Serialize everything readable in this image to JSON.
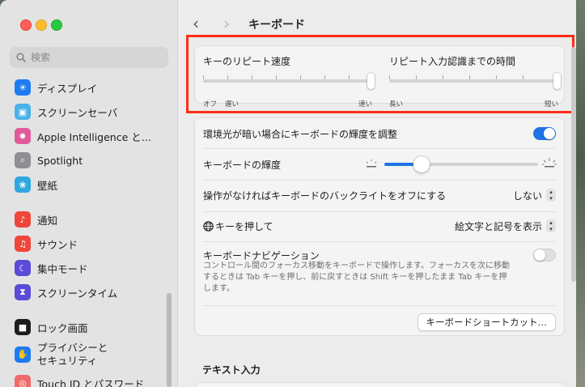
{
  "window": {
    "title": "キーボード"
  },
  "search": {
    "placeholder": "検索"
  },
  "sidebar": {
    "items": [
      {
        "label": "ディスプレイ",
        "icon": "display-icon",
        "color": "#1d7cf2"
      },
      {
        "label": "スクリーンセーバ",
        "icon": "screensaver-icon",
        "color": "#4ab2e8"
      },
      {
        "label": "Apple Intelligence と…",
        "icon": "apple-intelligence-icon",
        "color": "#e05b9c"
      },
      {
        "label": "Spotlight",
        "icon": "magnifier-icon",
        "color": "#8e8e93"
      },
      {
        "label": "壁紙",
        "icon": "wallpaper-icon",
        "color": "#2fa8e0"
      },
      {
        "label": "通知",
        "icon": "bell-icon",
        "color": "#f0453a"
      },
      {
        "label": "サウンド",
        "icon": "speaker-icon",
        "color": "#f0453a"
      },
      {
        "label": "集中モード",
        "icon": "moon-icon",
        "color": "#5b4bd8"
      },
      {
        "label": "スクリーンタイム",
        "icon": "hourglass-icon",
        "color": "#5b4bd8"
      },
      {
        "label": "ロック画面",
        "icon": "lock-icon",
        "color": "#1d1d1f"
      },
      {
        "label": "プライバシーと\nセキュリティ",
        "icon": "hand-icon",
        "color": "#1d7cf2"
      },
      {
        "label": "Touch ID とパスワード",
        "icon": "fingerprint-icon",
        "color": "#f06a6a"
      }
    ]
  },
  "repeat": {
    "key_repeat_label": "キーのリピート速度",
    "key_repeat_ticks": [
      "オフ",
      "遅い",
      "速い"
    ],
    "key_repeat_value": 1.0,
    "delay_label": "リピート入力認識までの時間",
    "delay_ticks": [
      "長い",
      "短い"
    ],
    "delay_value": 1.0
  },
  "settings": {
    "ambient": {
      "label": "環境光が暗い場合にキーボードの輝度を調整",
      "on": true
    },
    "brightness": {
      "label": "キーボードの輝度",
      "value": 0.24
    },
    "backlight_off": {
      "label": "操作がなければキーボードのバックライトをオフにする",
      "value": "しない"
    },
    "globe_key": {
      "label": "キーを押して",
      "value": "絵文字と記号を表示"
    },
    "navigation": {
      "label": "キーボードナビゲーション",
      "description": "コントロール間のフォーカス移動をキーボードで操作します。フォーカスを次に移動するときは Tab キーを押し、前に戻すときは Shift キーを押したまま Tab キーを押します。",
      "on": false
    },
    "shortcuts_button": "キーボードショートカット…"
  },
  "text_input": {
    "title": "テキスト入力"
  },
  "colors": {
    "accent": "#1f73e6",
    "highlight": "#ff2d14"
  }
}
